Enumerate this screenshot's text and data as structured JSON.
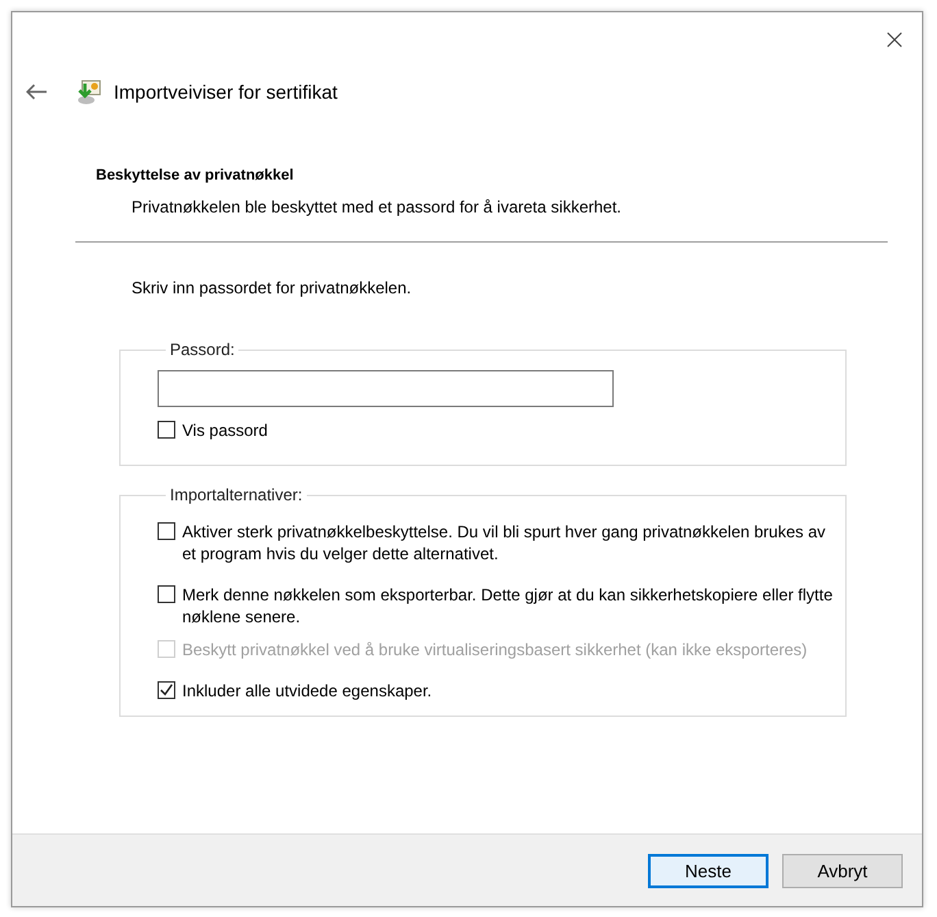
{
  "window": {
    "title": "Importveiviser for sertifikat"
  },
  "section": {
    "heading": "Beskyttelse av privatnøkkel",
    "description": "Privatnøkkelen ble beskyttet med et passord for å ivareta sikkerhet."
  },
  "instruction": "Skriv inn passordet for privatnøkkelen.",
  "password_group": {
    "label": "Passord:",
    "show_password": {
      "label": "Vis passord",
      "checked": false,
      "disabled": false
    }
  },
  "options_group": {
    "label": "Importalternativer:",
    "options": [
      {
        "label": "Aktiver sterk privatnøkkelbeskyttelse. Du vil bli spurt hver gang privatnøkkelen brukes av et program hvis du velger dette alternativet.",
        "checked": false,
        "disabled": false
      },
      {
        "label": "Merk denne nøkkelen som eksporterbar. Dette gjør at du kan sikkerhetskopiere eller flytte nøklene senere.",
        "checked": false,
        "disabled": false
      },
      {
        "label": "Beskytt privatnøkkel ved å bruke virtualiseringsbasert sikkerhet (kan ikke eksporteres)",
        "checked": false,
        "disabled": true
      },
      {
        "label": "Inkluder alle utvidede egenskaper.",
        "checked": true,
        "disabled": false
      }
    ]
  },
  "buttons": [
    {
      "label": "Neste",
      "default": true
    },
    {
      "label": "Avbryt",
      "default": false
    }
  ]
}
